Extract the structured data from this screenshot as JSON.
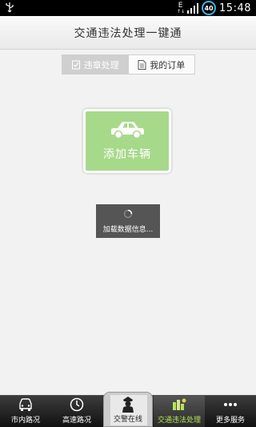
{
  "status_bar": {
    "network": "E",
    "battery": "40",
    "time": "15:48",
    "icons": [
      "usb-icon",
      "signal-icon",
      "battery-icon"
    ]
  },
  "title_bar": {
    "title": "交通违法处理一键通"
  },
  "tabs": [
    {
      "label": "违章处理",
      "icon": "checkbox-icon",
      "selected": true
    },
    {
      "label": "我的订单",
      "icon": "document-icon",
      "selected": false
    }
  ],
  "add_vehicle": {
    "label": "添加车辆",
    "icon": "car-icon"
  },
  "loading": {
    "text": "加载数据信息..."
  },
  "bottom_nav": [
    {
      "label": "市内路况",
      "icon": "car-front-icon"
    },
    {
      "label": "高速路况",
      "icon": "clock-icon"
    },
    {
      "label": "交警在线",
      "icon": "police-icon"
    },
    {
      "label": "交通违法处理",
      "icon": "violation-icon",
      "active": true
    },
    {
      "label": "更多服务",
      "icon": "more-icon"
    }
  ],
  "colors": {
    "accent_green": "#a7d98a",
    "active_nav_text": "#b6e35a",
    "battery_ring": "#33b5e5"
  }
}
